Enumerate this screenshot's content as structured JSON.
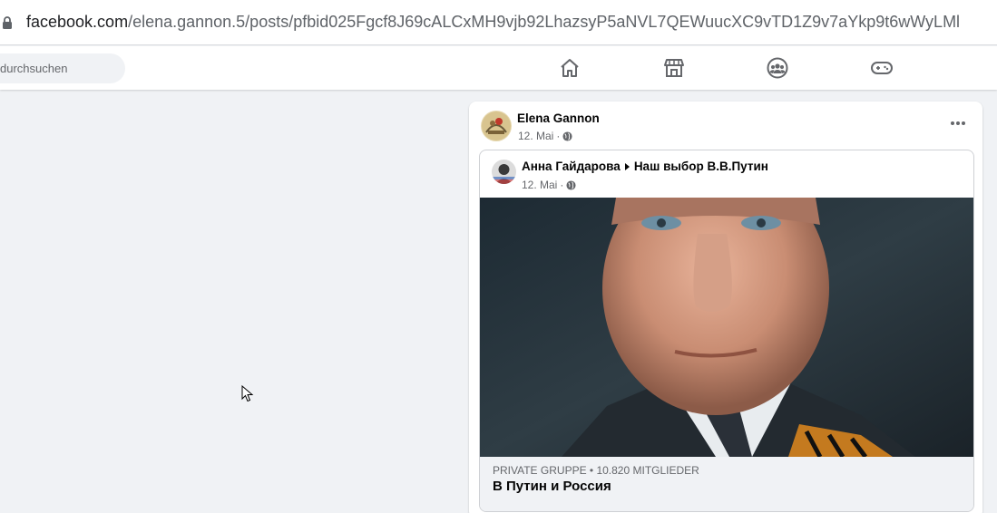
{
  "browser": {
    "url_host": "facebook.com",
    "url_path": "/elena.gannon.5/posts/pfbid025Fgcf8J69cALCxMH9vjb92LhazsyP5aNVL7QEWuucXC9vTD1Z9v7aYkp9t6wWyLMl"
  },
  "nav": {
    "search_placeholder": "durchsuchen",
    "icons": [
      "home-icon",
      "marketplace-icon",
      "groups-icon",
      "gaming-icon"
    ]
  },
  "post": {
    "author": "Elena Gannon",
    "date": "12. Mai",
    "separator": "·",
    "shared": {
      "author": "Анна Гайдарова",
      "group": "Наш выбор В.В.Путин",
      "date": "12. Mai",
      "separator": "·",
      "group_label": "PRIVATE GRUPPE • 10.820 MITGLIEDER",
      "group_name": "В Путин и Россия"
    }
  },
  "colors": {
    "background": "#f0f2f5",
    "secondary_text": "#65676b",
    "primary_text": "#050505"
  }
}
